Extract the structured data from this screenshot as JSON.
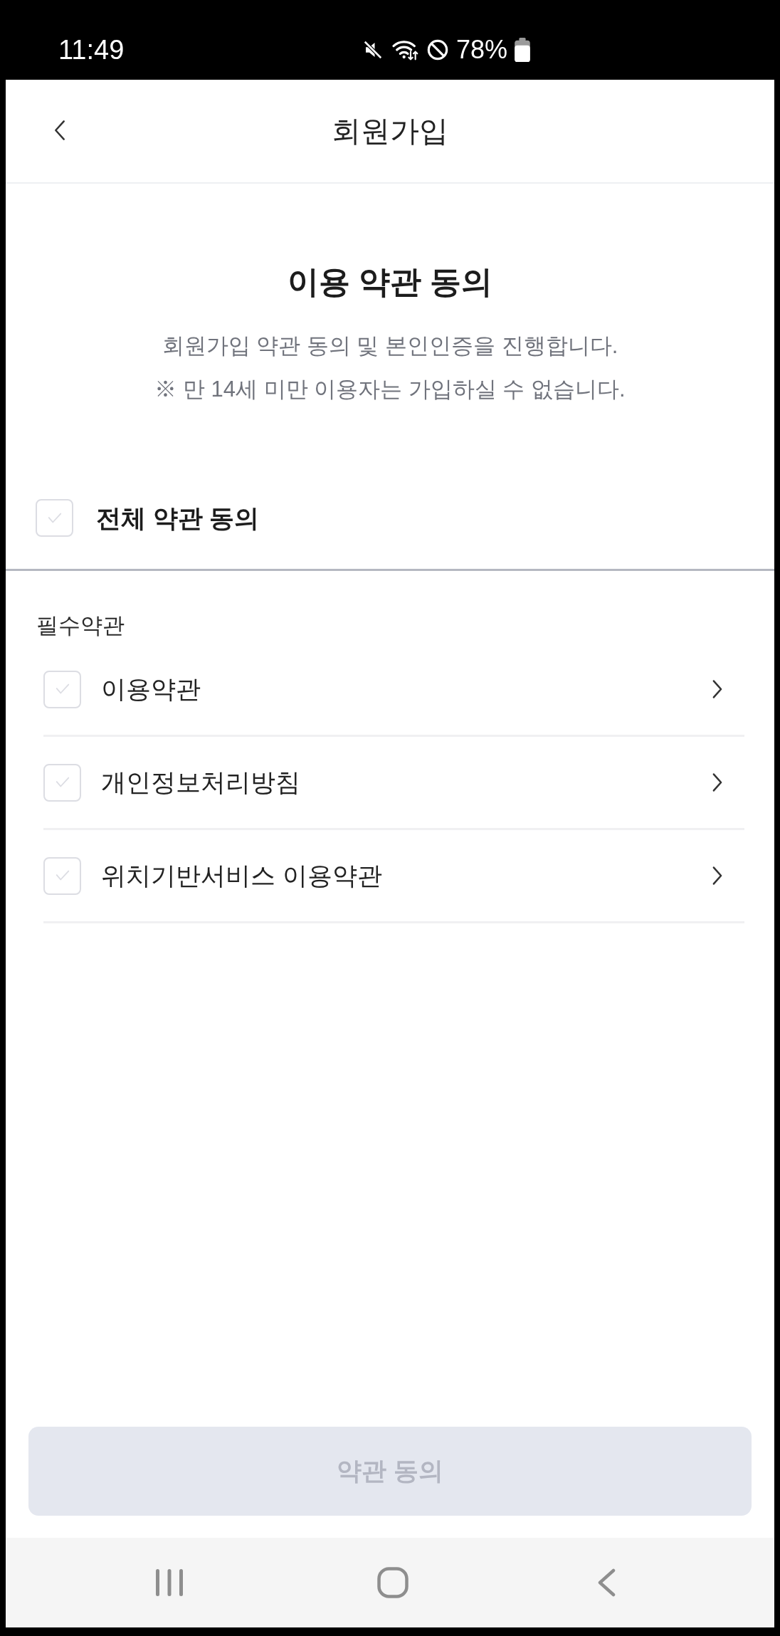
{
  "status_bar": {
    "time": "11:49",
    "battery": "78%"
  },
  "header": {
    "title": "회원가입"
  },
  "intro": {
    "title": "이용 약관 동의",
    "lines": [
      "회원가입 약관 동의 및 본인인증을 진행합니다.",
      "※ 만 14세 미만 이용자는 가입하실 수 없습니다."
    ]
  },
  "agree_all": {
    "label": "전체 약관 동의",
    "checked": false
  },
  "required_terms": {
    "heading": "필수약관",
    "items": [
      {
        "label": "이용약관",
        "checked": false
      },
      {
        "label": "개인정보처리방침",
        "checked": false
      },
      {
        "label": "위치기반서비스 이용약관",
        "checked": false
      }
    ]
  },
  "submit_button": {
    "label": "약관 동의",
    "disabled": true
  }
}
